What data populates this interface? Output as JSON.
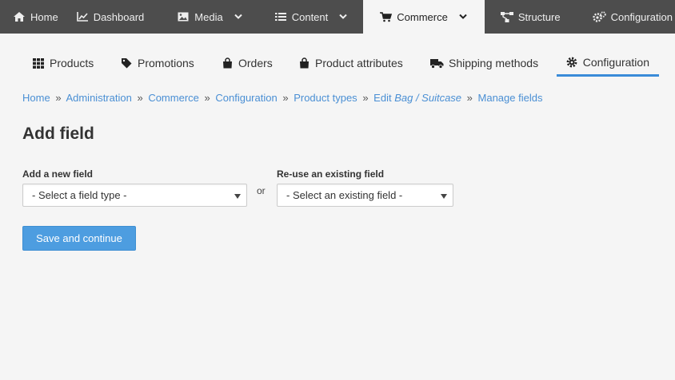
{
  "toolbar": {
    "items": [
      {
        "label": "Home",
        "icon": "home-icon"
      },
      {
        "label": "Dashboard",
        "icon": "chart-icon"
      },
      {
        "label": "Media",
        "icon": "image-icon"
      },
      {
        "label": "Content",
        "icon": "list-icon"
      },
      {
        "label": "Commerce",
        "icon": "cart-icon"
      },
      {
        "label": "Structure",
        "icon": "sitemap-icon"
      },
      {
        "label": "Configuration",
        "icon": "cogs-icon"
      }
    ]
  },
  "subtabs": {
    "items": [
      {
        "label": "Products",
        "icon": "grid-icon"
      },
      {
        "label": "Promotions",
        "icon": "tag-icon"
      },
      {
        "label": "Orders",
        "icon": "bag-icon"
      },
      {
        "label": "Product attributes",
        "icon": "bag-icon"
      },
      {
        "label": "Shipping methods",
        "icon": "truck-icon"
      },
      {
        "label": "Configuration",
        "icon": "gear-icon"
      }
    ]
  },
  "breadcrumb": {
    "home": "Home",
    "administration": "Administration",
    "commerce": "Commerce",
    "configuration": "Configuration",
    "product_types": "Product types",
    "edit_prefix": "Edit",
    "edit_item": "Bag / Suitcase",
    "manage_fields": "Manage fields",
    "separator": "»"
  },
  "page": {
    "title": "Add field"
  },
  "form": {
    "new_field_label": "Add a new field",
    "new_field_value": "- Select a field type -",
    "or_text": "or",
    "existing_field_label": "Re-use an existing field",
    "existing_field_value": "- Select an existing field -",
    "submit_label": "Save and continue"
  },
  "colors": {
    "toolbar_bg": "#4d4d4d",
    "accent": "#4d9de0",
    "link": "#4a8fd4"
  }
}
